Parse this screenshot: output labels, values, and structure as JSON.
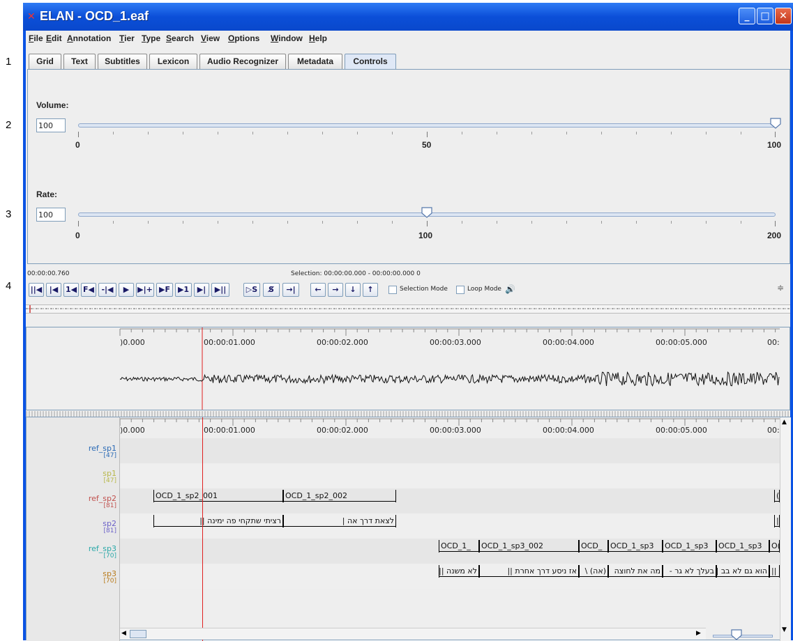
{
  "side_numbers": [
    "1",
    "2",
    "3",
    "4"
  ],
  "window": {
    "title": "ELAN - OCD_1.eaf",
    "controls": [
      "minimize",
      "maximize",
      "close"
    ]
  },
  "menu": [
    "File",
    "Edit",
    "Annotation",
    "Tier",
    "Type",
    "Search",
    "View",
    "Options",
    "Window",
    "Help"
  ],
  "tabs": [
    {
      "label": "Grid"
    },
    {
      "label": "Text"
    },
    {
      "label": "Subtitles"
    },
    {
      "label": "Lexicon"
    },
    {
      "label": "Audio Recognizer"
    },
    {
      "label": "Metadata"
    },
    {
      "label": "Controls",
      "active": true
    }
  ],
  "controls": {
    "volume": {
      "label": "Volume:",
      "value": "100",
      "min_label": "0",
      "mid_label": "50",
      "max_label": "100",
      "level": 100
    },
    "rate": {
      "label": "Rate:",
      "value": "100",
      "min_label": "0",
      "mid_label": "100",
      "max_label": "200",
      "level": 100
    }
  },
  "media": {
    "current_time": "00:00:00.760",
    "selection": "Selection: 00:00:00.000 - 00:00:00.000 0",
    "buttons": [
      "||◀",
      "|◀",
      "1◀",
      "F◀",
      "-|◀",
      "▶",
      "▶|+",
      "▶F",
      "▶1",
      "▶|",
      "▶||"
    ],
    "sel_buttons": [
      "▷S",
      "S̸",
      "→|"
    ],
    "nav_buttons": [
      "←",
      "→",
      "↓",
      "↑"
    ],
    "selection_mode": "Selection Mode",
    "loop_mode": "Loop Mode"
  },
  "ruler": {
    "labels": [
      ")0.000",
      "00:00:01.000",
      "00:00:02.000",
      "00:00:03.000",
      "00:00:04.000",
      "00:00:05.000",
      "00:"
    ]
  },
  "tiers": [
    {
      "name": "ref_sp1",
      "count": "[47]",
      "color": "#2a6ab5"
    },
    {
      "name": "sp1",
      "count": "[47]",
      "color": "#b8b84a"
    },
    {
      "name": "ref_sp2",
      "count": "[81]",
      "color": "#c0504d"
    },
    {
      "name": "sp2",
      "count": "[81]",
      "color": "#6a5fc8"
    },
    {
      "name": "ref_sp3",
      "count": "[70]",
      "color": "#2aa8a8"
    },
    {
      "name": "sp3",
      "count": "[70]",
      "color": "#b87a1a"
    }
  ],
  "annotations": {
    "ref_sp2": [
      "OCD_1_sp2_001",
      "OCD_1_sp2_002",
      "(",
      ""
    ],
    "sp2": [
      "רציתי שתקחי פה ימינה ||",
      "לצאת דרך אה |",
      "|"
    ],
    "ref_sp3": [
      "OCD_1_",
      "OCD_1_sp3_002",
      "OCD_",
      "OCD_1_sp3",
      "OCD_1_sp3",
      "OCD_1_sp3",
      "O("
    ],
    "sp3": [
      "לא משנה ||",
      "אז ניסע דרך אחרת ||",
      "(אה) \\",
      "מה את לחוצה",
      "בעלך לא גר -",
      "הוא גם לא בב ||",
      "||"
    ]
  }
}
